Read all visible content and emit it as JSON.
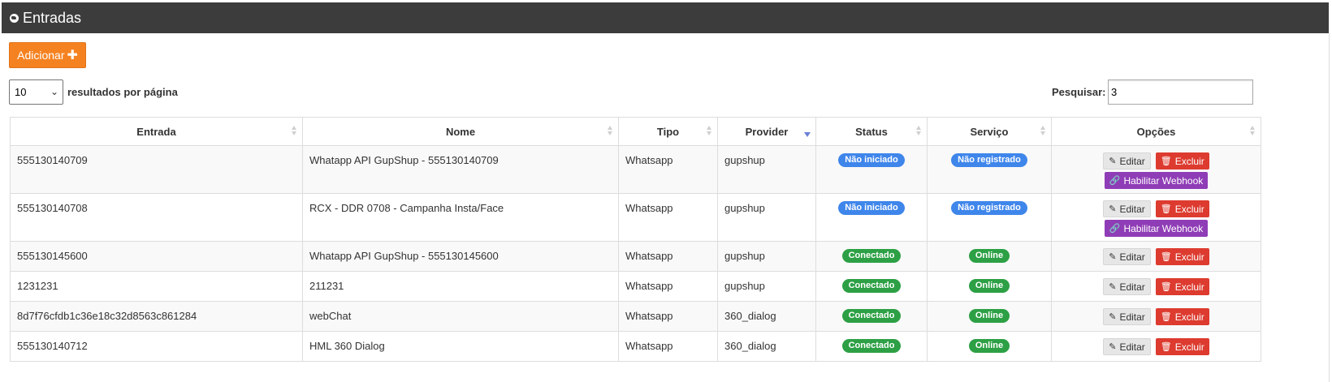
{
  "panel": {
    "title": "Entradas"
  },
  "toolbar": {
    "add_label": "Adicionar",
    "add_icon": "plus-icon"
  },
  "length": {
    "value": "10",
    "label": "resultados por página"
  },
  "search": {
    "label": "Pesquisar:",
    "value": "3"
  },
  "table": {
    "columns": [
      "Entrada",
      "Nome",
      "Tipo",
      "Provider",
      "Status",
      "Serviço",
      "Opções"
    ],
    "sorted_column": "Provider",
    "edit_label": "Editar",
    "delete_label": "Excluir",
    "webhook_label": "Habilitar Webhook",
    "rows": [
      {
        "entrada": "555130140709",
        "nome": "Whatapp API GupShup - 555130140709",
        "tipo": "Whatsapp",
        "provider": "gupshup",
        "status": "Não iniciado",
        "servico": "Não registrado"
      },
      {
        "entrada": "555130140708",
        "nome": "RCX - DDR 0708 - Campanha Insta/Face",
        "tipo": "Whatsapp",
        "provider": "gupshup",
        "status": "Não iniciado",
        "servico": "Não registrado"
      },
      {
        "entrada": "555130145600",
        "nome": "Whatapp API GupShup - 555130145600",
        "tipo": "Whatsapp",
        "provider": "gupshup",
        "status": "Conectado",
        "servico": "Online"
      },
      {
        "entrada": "1231231",
        "nome": "211231",
        "tipo": "Whatsapp",
        "provider": "gupshup",
        "status": "Conectado",
        "servico": "Online"
      },
      {
        "entrada": "8d7f76cfdb1c36e18c32d8563c861284",
        "nome": "webChat",
        "tipo": "Whatsapp",
        "provider": "360_dialog",
        "status": "Conectado",
        "servico": "Online"
      },
      {
        "entrada": "555130140712",
        "nome": "HML 360 Dialog",
        "tipo": "Whatsapp",
        "provider": "360_dialog",
        "status": "Conectado",
        "servico": "Online"
      }
    ]
  },
  "colors": {
    "header_bg": "#3c3c3c",
    "add_button": "#f58220",
    "badge_blue": "#3f86eb",
    "badge_green": "#2da045",
    "delete_button": "#dd3b2f",
    "webhook_button": "#8f3db6"
  }
}
